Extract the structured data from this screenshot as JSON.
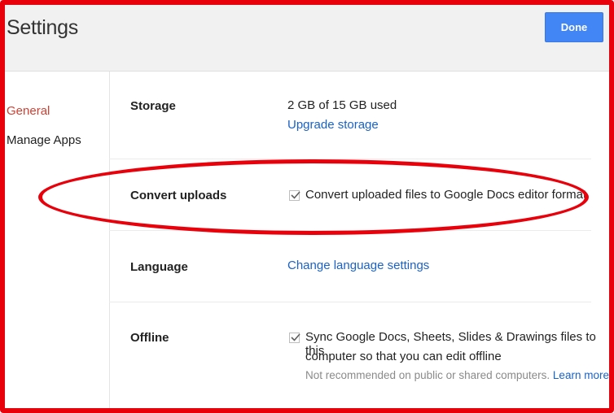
{
  "header": {
    "title": "Settings",
    "done_label": "Done"
  },
  "sidebar": {
    "items": [
      {
        "label": "General",
        "active": true
      },
      {
        "label": "Manage Apps",
        "active": false
      }
    ]
  },
  "storage": {
    "label": "Storage",
    "usage": "2 GB of 15 GB used",
    "upgrade_link": "Upgrade storage"
  },
  "convert": {
    "label": "Convert uploads",
    "checked": true,
    "option_text": "Convert uploaded files to Google Docs editor format"
  },
  "language": {
    "label": "Language",
    "link": "Change language settings"
  },
  "offline": {
    "label": "Offline",
    "checked": true,
    "option_line1": "Sync Google Docs, Sheets, Slides & Drawings files to this",
    "option_line2": "computer so that you can edit offline",
    "note": "Not recommended on public or shared computers.",
    "learn_more": "Learn more"
  },
  "colors": {
    "accent": "#4285f4",
    "active_nav": "#d23f31",
    "link": "#1a62c6",
    "annotation": "#e8000b"
  }
}
